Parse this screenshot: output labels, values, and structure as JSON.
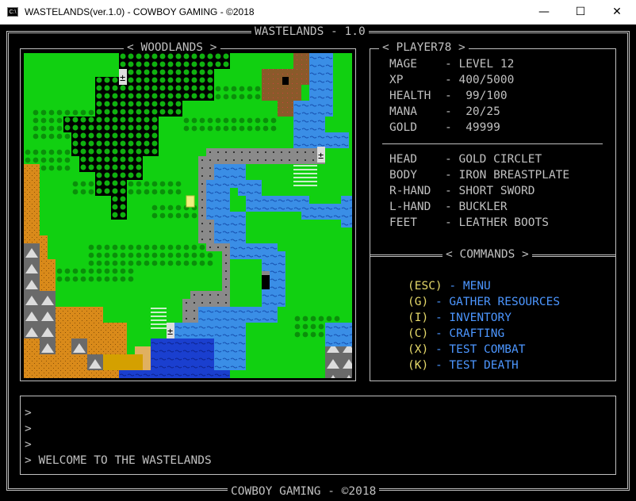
{
  "window": {
    "title": "WASTELANDS(ver.1.0) - COWBOY GAMING - ©2018",
    "icon_text": "C:\\",
    "minimize": "—",
    "maximize": "☐",
    "close": "✕"
  },
  "header": {
    "title": "WASTELANDS - 1.0"
  },
  "footer": {
    "text": "COWBOY GAMING - ©2018"
  },
  "map": {
    "label": "< WOODLANDS >"
  },
  "player": {
    "label": "< PLAYER78 >",
    "stats": [
      {
        "name": "MAGE",
        "value": "LEVEL 12"
      },
      {
        "name": "XP",
        "value": "400/5000"
      },
      {
        "name": "HEALTH",
        "value": " 99/100"
      },
      {
        "name": "MANA",
        "value": " 20/25"
      },
      {
        "name": "GOLD",
        "value": " 49999"
      }
    ],
    "equipment": [
      {
        "slot": "HEAD",
        "item": "GOLD CIRCLET"
      },
      {
        "slot": "BODY",
        "item": "IRON BREASTPLATE"
      },
      {
        "slot": "R-HAND",
        "item": "SHORT SWORD"
      },
      {
        "slot": "L-HAND",
        "item": "BUCKLER"
      },
      {
        "slot": "FEET",
        "item": "LEATHER BOOTS"
      }
    ]
  },
  "commands": {
    "label": "< COMMANDS >",
    "items": [
      {
        "key": "(ESC)",
        "label": "MENU"
      },
      {
        "key": "(G)",
        "label": "GATHER RESOURCES"
      },
      {
        "key": "(I)",
        "label": "INVENTORY"
      },
      {
        "key": "(C)",
        "label": "CRAFTING"
      },
      {
        "key": "(X)",
        "label": "TEST COMBAT"
      },
      {
        "key": "(K)",
        "label": "TEST DEATH"
      }
    ]
  },
  "log": {
    "prompt": ">",
    "lines": [
      "",
      "",
      "",
      "WELCOME TO THE WASTELANDS"
    ]
  },
  "colors": {
    "grass": "#11d011",
    "forest": "#000000",
    "water": "#3a8ee6",
    "road": "#8a8a8a",
    "sand": "#d98a1a",
    "mountain": "#6a6a6a",
    "key": "#e6d96a",
    "command": "#4c96ff"
  },
  "icons": {
    "window": "console-icon",
    "player_marker": "player-marker-icon",
    "town": "town-icon"
  }
}
